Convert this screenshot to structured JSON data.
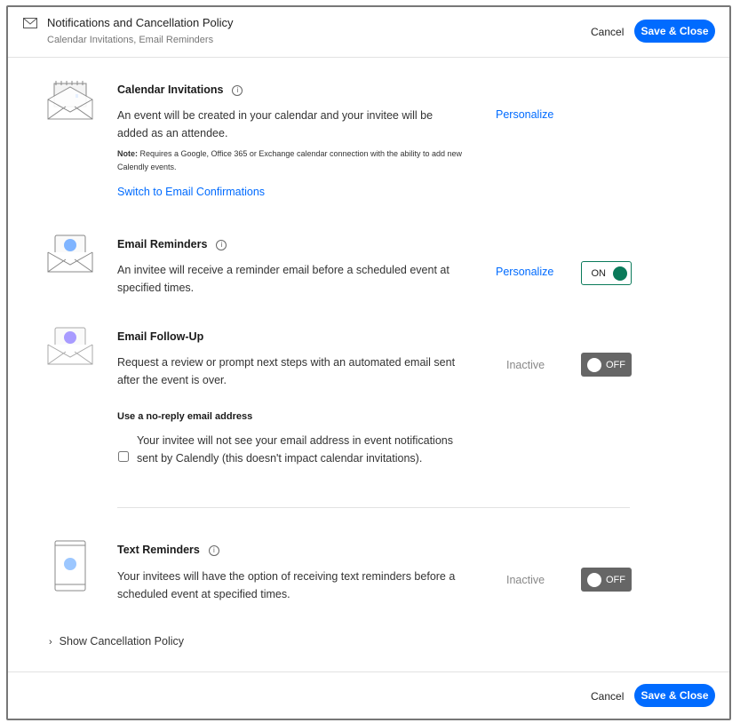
{
  "header": {
    "title": "Notifications and Cancellation Policy",
    "subtitle": "Calendar Invitations, Email Reminders",
    "cancel": "Cancel",
    "save": "Save & Close"
  },
  "calendar": {
    "title": "Calendar Invitations",
    "description": "An event will be created in your calendar and your invitee will be added as an attendee.",
    "note_label": "Note:",
    "note": " Requires a Google, Office 365 or Exchange calendar connection with the ability to add new Calendly events.",
    "personalize": "Personalize",
    "switch_link": "Switch to Email Confirmations"
  },
  "reminders": {
    "title": "Email Reminders",
    "description": "An invitee will receive a reminder email before a scheduled event at specified times.",
    "personalize": "Personalize",
    "toggle": "ON"
  },
  "followup": {
    "title": "Email Follow-Up",
    "description": "Request a review or prompt next steps with an automated email sent after the event is over.",
    "status": "Inactive",
    "toggle": "OFF"
  },
  "noreply": {
    "title": "Use a no-reply email address",
    "description": "Your invitee will not see your email address in event notifications sent by Calendly (this doesn't impact calendar invitations).",
    "checked": false
  },
  "text": {
    "title": "Text Reminders",
    "description": "Your invitees will have the option of receiving text reminders before a scheduled event at specified times.",
    "status": "Inactive",
    "toggle": "OFF"
  },
  "cancellation": {
    "label": "Show Cancellation Policy"
  },
  "footer": {
    "cancel": "Cancel",
    "save": "Save & Close"
  },
  "colors": {
    "accent": "#006bff",
    "on": "#0a7a5a",
    "off": "#666666"
  }
}
